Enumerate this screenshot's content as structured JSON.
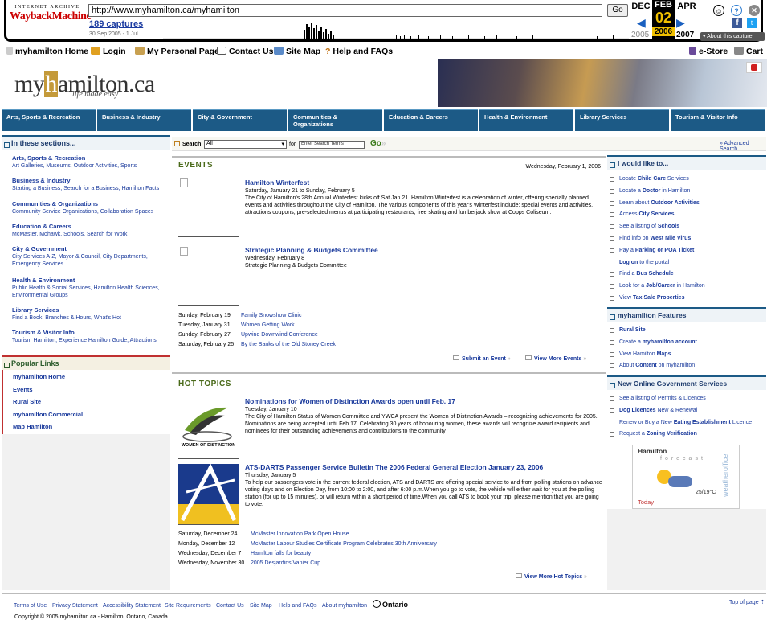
{
  "wayback": {
    "logo_top": "INTERNET ARCHIVE",
    "logo_main": "WaybackMachine",
    "url": "http://www.myhamilton.ca/myhamilton",
    "go": "Go",
    "captures": "189 captures",
    "range": "30 Sep 2005 - 1 Jul",
    "month_prev": "DEC",
    "month_cur": "FEB",
    "month_next": "APR",
    "day": "02",
    "year_prev": "2005",
    "year_cur": "2006",
    "year_next": "2007",
    "about": "About this capture"
  },
  "topnav": {
    "home": "myhamilton Home",
    "login": "Login",
    "personal": "My Personal Page",
    "contact": "Contact Us",
    "sitemap": "Site Map",
    "help": "Help and FAQs",
    "estore": "e-Store",
    "cart": "Cart"
  },
  "header": {
    "logo_pre": "my",
    "logo_h": "h",
    "logo_post": "amilton.ca",
    "tagline": "life made easy"
  },
  "tabs": [
    "Arts, Sports & Recreation",
    "Business & Industry",
    "City & Government",
    "Communities & Organizations",
    "Education & Careers",
    "Health & Environment",
    "Library Services",
    "Tourism & Visitor Info"
  ],
  "sections": {
    "title": "In these sections...",
    "items": [
      {
        "h": "Arts, Sports & Recreation",
        "s": "Art Galleries, Museums, Outdoor Activities, Sports"
      },
      {
        "h": "Business & Industry",
        "s": "Starting a Business, Search for a Business, Hamilton Facts"
      },
      {
        "h": "Communities & Organizations",
        "s": "Community Service Organizations, Collaboration Spaces"
      },
      {
        "h": "Education & Careers",
        "s": "McMaster, Mohawk, Schools, Search for Work"
      },
      {
        "h": "City & Government",
        "s": "City Services A-Z, Mayor & Council, City Departments, Emergency Services"
      },
      {
        "h": "Health & Environment",
        "s": "Public Health & Social Services, Hamilton Health Sciences, Environmental Groups"
      },
      {
        "h": "Library Services",
        "s": "Find a Book, Branches & Hours, What's Hot"
      },
      {
        "h": "Tourism & Visitor Info",
        "s": "Tourism Hamilton, Experience Hamilton Guide, Attractions"
      }
    ]
  },
  "popular": {
    "title": "Popular Links",
    "items": [
      "myhamilton Home",
      "Events",
      "Rural Site",
      "myhamilton Commercial",
      "Map Hamilton"
    ]
  },
  "search": {
    "label": "Search",
    "select": "All",
    "for": "for",
    "placeholder": "Enter Search Terms",
    "go": "Go",
    "advanced": "Advanced Search"
  },
  "events": {
    "title": "EVENTS",
    "date": "Wednesday, February 1, 2006",
    "items": [
      {
        "title": "Hamilton Winterfest",
        "date": "Saturday, January 21 to Sunday, February 5",
        "desc": "The City of Hamilton's 28th Annual Winterfest kicks off Sat Jan 21. Hamilton Winterfest is a celebration of winter, offering specially planned events and activities throughout the City of Hamilton. The various components of this year's Winterfest include; special events and activities, attractions coupons, pre-selected menus at participating restaurants, free skating and lumberjack show at Copps Coliseum."
      },
      {
        "title": "Strategic Planning & Budgets Committee",
        "date": "Wednesday, February 8",
        "desc": "Strategic Planning & Budgets Committee"
      }
    ],
    "list": [
      {
        "d": "Sunday, February 19",
        "t": "Family Snowshow Clinic"
      },
      {
        "d": "Tuesday, January 31",
        "t": "Women Getting Work"
      },
      {
        "d": "Sunday, February 27",
        "t": "Upwind Downwind Conference"
      },
      {
        "d": "Saturday, February 25",
        "t": "By the Banks of the Old Stoney Creek"
      }
    ],
    "submit": "Submit an Event",
    "more": "View More Events"
  },
  "hot": {
    "title": "HOT TOPICS",
    "items": [
      {
        "title": "Nominations for Women of Distinction Awards open until Feb. 17",
        "date": "Tuesday, January 10",
        "desc": "The City of Hamilton Status of Women Committee and YWCA present the Women of Distinction Awards – recognizing achievements for 2005. Nominations are being accepted until Feb.17. Celebrating 30 years of honouring women, these awards will recognize award recipients and nominees for their outstanding achievements and contributions to the community",
        "logo": "WOMEN OF DISTINCTION"
      },
      {
        "title": "ATS-DARTS Passenger Service Bulletin The 2006 Federal General Election January 23, 2006",
        "date": "Thursday, January 5",
        "desc": "To help our passengers vote in the current federal election, ATS and DARTS are offering special service to and from polling stations on advance voting days and on Election Day, from 10:00 to 2:00, and after 6:00 p.m.When you go to vote, the vehicle will either wait for you at the polling station (for up to 15 minutes), or will return within a short period of time.When you call ATS to book your trip, please mention that you are going to vote."
      }
    ],
    "list": [
      {
        "d": "Saturday, December 24",
        "t": "McMaster Innovation Park Open House"
      },
      {
        "d": "Monday, December 12",
        "t": "McMaster Labour Studies Certificate Program Celebrates 30th Anniversary"
      },
      {
        "d": "Wednesday, December 7",
        "t": "Hamilton falls for beauty"
      },
      {
        "d": "Wednesday, November 30",
        "t": "2005 Desjardins Vanier Cup"
      }
    ],
    "more": "View More Hot Topics"
  },
  "right": {
    "like_title": "I would like to...",
    "like": [
      [
        "Locate ",
        "Child Care",
        " Services"
      ],
      [
        "Locate a ",
        "Doctor",
        " in Hamilton"
      ],
      [
        "Learn about ",
        "Outdoor Activities",
        ""
      ],
      [
        "Access ",
        "City Services",
        ""
      ],
      [
        "See a listing of ",
        "Schools",
        ""
      ],
      [
        "Find info on ",
        "West Nile Virus",
        ""
      ],
      [
        "Pay a ",
        "Parking or POA Ticket",
        ""
      ],
      [
        "",
        "Log on",
        " to the portal"
      ],
      [
        "Find a ",
        "Bus Schedule",
        ""
      ],
      [
        "Look for a ",
        "Job/Career",
        " in Hamilton"
      ],
      [
        "View ",
        "Tax Sale Properties",
        ""
      ]
    ],
    "feat_title": "myhamilton Features",
    "feat": [
      [
        "",
        "Rural Site",
        ""
      ],
      [
        "Create a ",
        "myhamilton account",
        ""
      ],
      [
        "View Hamilton ",
        "Maps",
        ""
      ],
      [
        "About ",
        "Content",
        " on myhamilton"
      ]
    ],
    "gov_title": "New Online Government Services",
    "gov": [
      [
        "See a listing of Permits & Licences",
        "",
        ""
      ],
      [
        "",
        "Dog Licences",
        " New & Renewal"
      ],
      [
        "Renew or Buy a New ",
        "Eating Establishment",
        " Licence"
      ],
      [
        "Request a ",
        "Zoning Verification",
        ""
      ]
    ],
    "weather": {
      "city": "Hamilton",
      "label": "forecast",
      "temp": "25/19°C",
      "today": "Today",
      "brand": "weatheroffice"
    }
  },
  "footer": {
    "links": [
      "Terms of Use",
      "Privacy Statement",
      "Accessibility Statement",
      "Site Requirements",
      "Contact Us",
      "Site Map",
      "Help and FAQs",
      "About myhamilton"
    ],
    "ontario": "Ontario",
    "top": "Top of page",
    "copyright": "Copyright © 2005 myhamilton.ca - Hamilton, Ontario, Canada"
  }
}
